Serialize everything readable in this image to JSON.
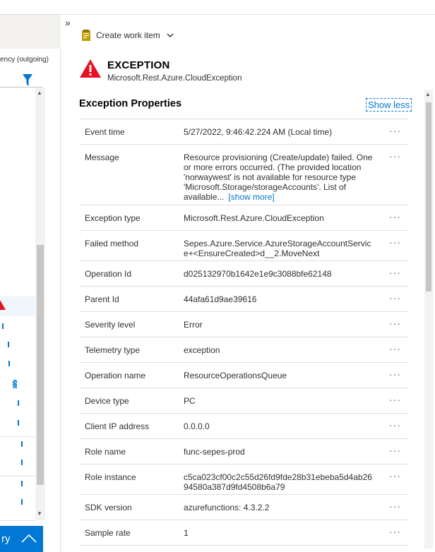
{
  "left_pane": {
    "column_label": "ency (outgoing)",
    "bottom_button_label": "ry"
  },
  "right_pane": {
    "expand_glyph": "»",
    "work_item_label": "Create work item",
    "exception_title": "EXCEPTION",
    "exception_type": "Microsoft.Rest.Azure.CloudException",
    "section_title": "Exception Properties",
    "show_less": "Show less",
    "show_more": "[show more]",
    "more_glyph": "···",
    "properties": [
      {
        "key": "Event time",
        "value": "5/27/2022, 9:46:42.224 AM (Local time)"
      },
      {
        "key": "Message",
        "value": "Resource provisioning (Create/update) failed. One or more errors occurred. (The provided location 'norwaywest' is not available for resource type 'Microsoft.Storage/storageAccounts'. List of available..."
      },
      {
        "key": "Exception type",
        "value": "Microsoft.Rest.Azure.CloudException"
      },
      {
        "key": "Failed method",
        "value": "Sepes.Azure.Service.AzureStorageAccountService+<EnsureCreated>d__2.MoveNext"
      },
      {
        "key": "Operation Id",
        "value": "d025132970b1642e1e9c3088bfe62148"
      },
      {
        "key": "Parent Id",
        "value": "44afa61d9ae39616"
      },
      {
        "key": "Severity level",
        "value": "Error"
      },
      {
        "key": "Telemetry type",
        "value": "exception"
      },
      {
        "key": "Operation name",
        "value": "ResourceOperationsQueue"
      },
      {
        "key": "Device type",
        "value": "PC"
      },
      {
        "key": "Client IP address",
        "value": "0.0.0.0"
      },
      {
        "key": "Role name",
        "value": "func-sepes-prod"
      },
      {
        "key": "Role instance",
        "value": "c5ca023cf00c2c55d26fd9fde28b31ebeba5d4ab2694580a387d9fd4508b6a79"
      },
      {
        "key": "SDK version",
        "value": "azurefunctions: 4.3.2.2"
      },
      {
        "key": "Sample rate",
        "value": "1"
      }
    ]
  },
  "colors": {
    "accent": "#0078d4",
    "error": "#e81123",
    "border": "#e1dfdd"
  },
  "icons": [
    "expand-icon",
    "work-item-icon",
    "chevron-down-icon",
    "error-triangle-icon",
    "filter-icon",
    "more-icon",
    "chevron-up-icon"
  ]
}
